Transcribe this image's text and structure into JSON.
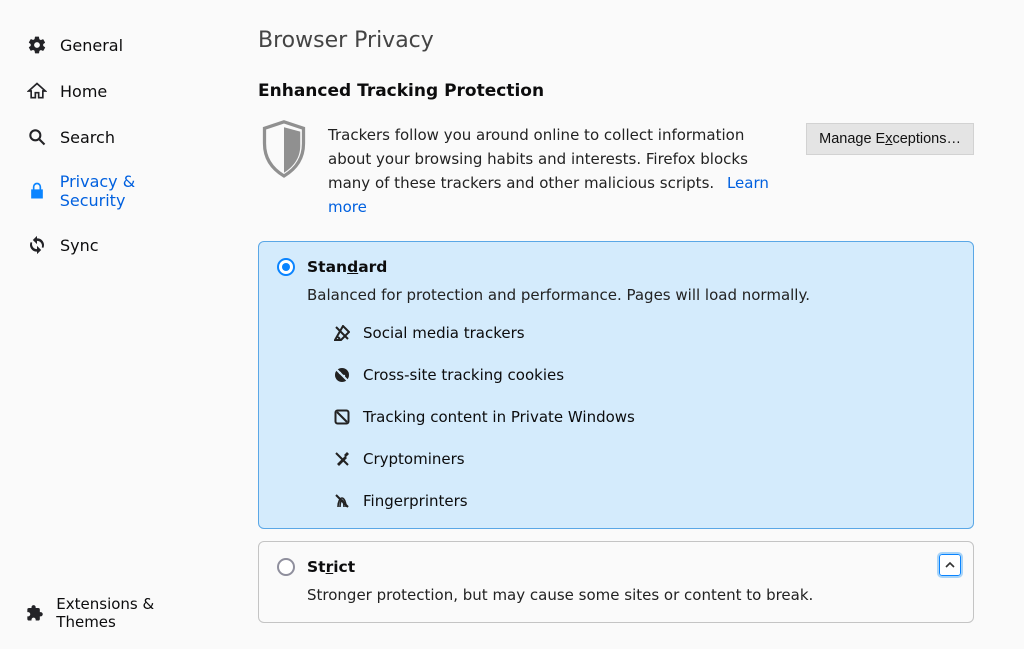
{
  "sidebar": {
    "items": [
      {
        "label": "General"
      },
      {
        "label": "Home"
      },
      {
        "label": "Search"
      },
      {
        "label": "Privacy & Security"
      },
      {
        "label": "Sync"
      }
    ],
    "bottom": {
      "label": "Extensions & Themes"
    }
  },
  "page": {
    "title": "Browser Privacy",
    "section_title": "Enhanced Tracking Protection",
    "intro": "Trackers follow you around online to collect information about your browsing habits and interests. Firefox blocks many of these trackers and other malicious scripts.",
    "learn_more": "Learn more",
    "manage_btn_pre": "Manage E",
    "manage_btn_u": "x",
    "manage_btn_post": "ceptions…"
  },
  "options": {
    "standard": {
      "title_pre": "Stan",
      "title_u": "d",
      "title_post": "ard",
      "desc": "Balanced for protection and performance. Pages will load normally.",
      "features": [
        "Social media trackers",
        "Cross-site tracking cookies",
        "Tracking content in Private Windows",
        "Cryptominers",
        "Fingerprinters"
      ]
    },
    "strict": {
      "title_pre": "St",
      "title_u": "r",
      "title_post": "ict",
      "desc": "Stronger protection, but may cause some sites or content to break."
    }
  }
}
